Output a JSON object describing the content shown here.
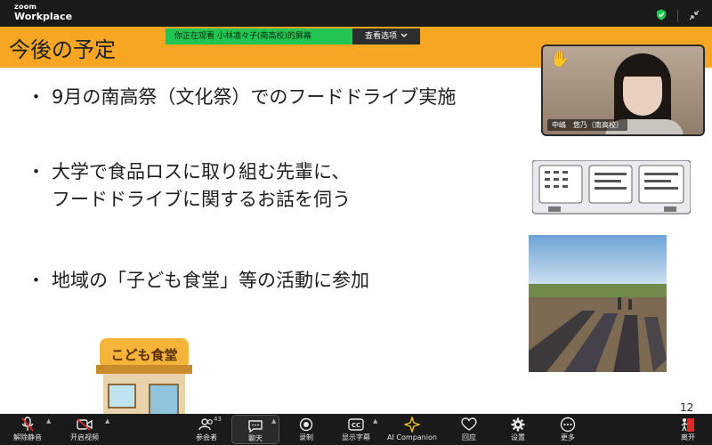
{
  "app": {
    "brand_small": "zoom",
    "brand_large": "Workplace"
  },
  "slide": {
    "title": "今後の予定",
    "bullets": [
      {
        "lines": [
          "9月の南高祭（文化祭）でのフードドライブ実施"
        ]
      },
      {
        "lines": [
          "大学で食品ロスに取り組む先輩に、",
          "フードドライブに関するお話を伺う"
        ]
      },
      {
        "lines": [
          "地域の「子ども食堂」等の活動に参加"
        ]
      }
    ],
    "shop_sign": "こども食堂",
    "page_number": "12"
  },
  "share_banner": {
    "viewing_text": "你正在观看 小林凛々子(南高校)的屏幕",
    "view_options": "查看选项"
  },
  "video": {
    "participant_name": "中嶋　悠乃（南高校）",
    "reaction": "✋"
  },
  "toolbar": {
    "unmute": "解除静音",
    "start_video": "开启视频",
    "participants": "参会者",
    "participants_count": "43",
    "chat": "聊天",
    "record": "录制",
    "captions": "显示字幕",
    "ai_companion": "AI Companion",
    "reactions": "回应",
    "settings": "设置",
    "more": "更多",
    "leave": "离开"
  },
  "colors": {
    "header": "#f6a623",
    "share_green": "#23c552",
    "leave_red": "#e02828",
    "secure_green": "#23c552"
  }
}
